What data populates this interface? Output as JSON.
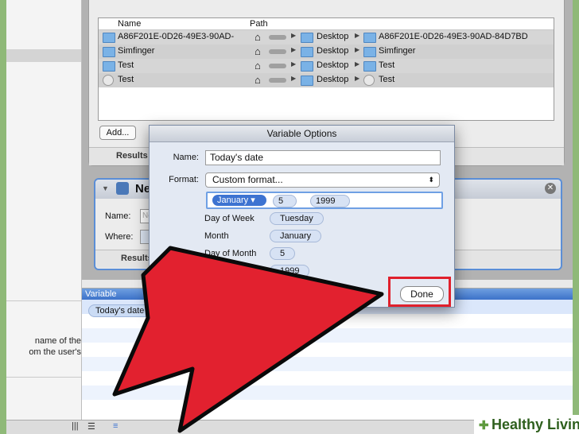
{
  "files_action": {
    "columns": [
      "Name",
      "Path"
    ],
    "rows": [
      {
        "name": "A86F201E-0D26-49E3-90AD-",
        "path": [
          "Desktop",
          "A86F201E-0D26-49E3-90AD-84D7BD"
        ],
        "icon": "folder-icon"
      },
      {
        "name": "Simfinger",
        "path": [
          "Desktop",
          "Simfinger"
        ],
        "icon": "folder-icon"
      },
      {
        "name": "Test",
        "path": [
          "Desktop",
          "Test"
        ],
        "icon": "folder-icon"
      },
      {
        "name": "Test",
        "path": [
          "Desktop",
          "Test"
        ],
        "icon": "gear-icon"
      }
    ],
    "add_label": "Add...",
    "results_label": "Results"
  },
  "new_action": {
    "title": "New",
    "name_label": "Name:",
    "name_placeholder": "Ne",
    "where_label": "Where:",
    "results_label": "Results"
  },
  "variable_pane": {
    "header": "Variable",
    "item": "Today's date"
  },
  "left_pane": {
    "description": [
      "name of the",
      "om the user's"
    ]
  },
  "dialog": {
    "title": "Variable Options",
    "name_label": "Name:",
    "name_value": "Today's date",
    "format_label": "Format:",
    "format_value": "Custom format...",
    "tokens": [
      "January",
      "5",
      "1999"
    ],
    "options": [
      {
        "label": "Day of Week",
        "value": "Tuesday"
      },
      {
        "label": "Month",
        "value": "January"
      },
      {
        "label": "Day of Month",
        "value": "5"
      },
      {
        "label": "",
        "value": "1999"
      }
    ],
    "done_label": "Done"
  },
  "watermark": {
    "text": "Healthy Living"
  },
  "colors": {
    "annotation_red": "#e0202c",
    "selection_blue": "#3d73d1"
  }
}
